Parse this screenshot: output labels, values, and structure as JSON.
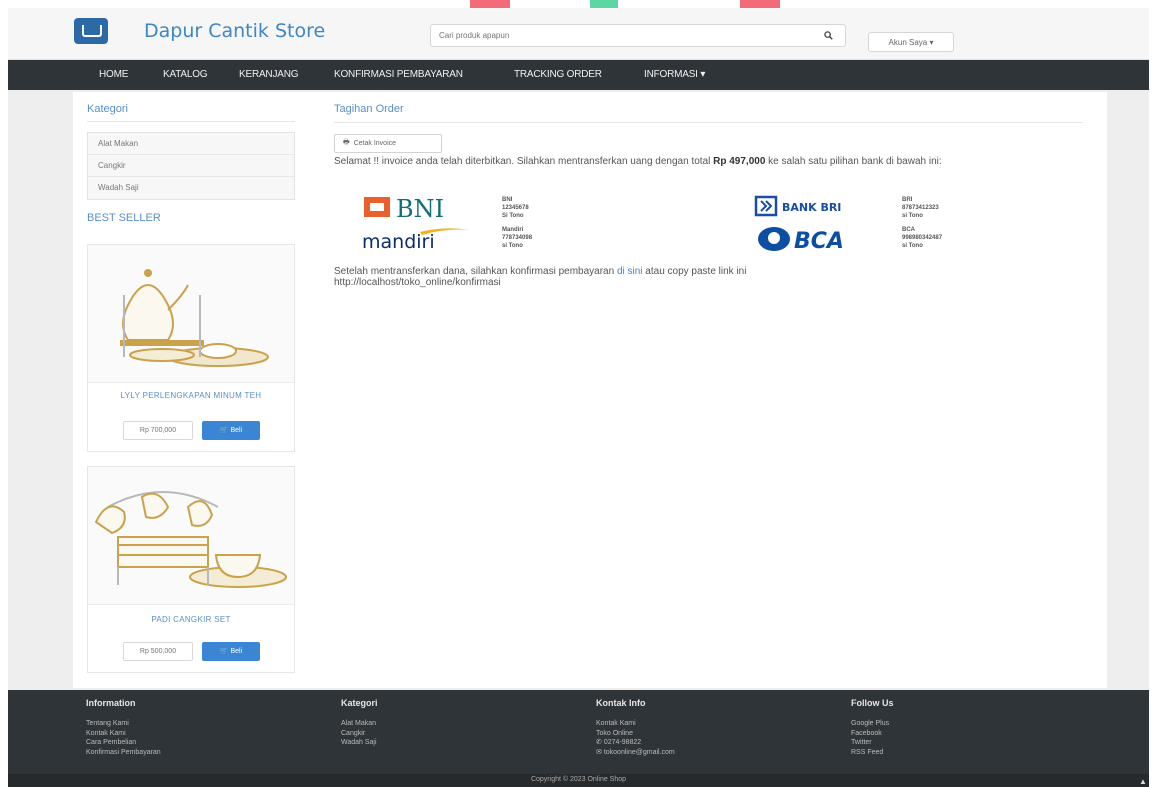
{
  "header": {
    "store_name": "Dapur Cantik Store",
    "search_placeholder": "Cari produk apapun",
    "account_label": "Akun Saya ▾"
  },
  "nav": {
    "items": [
      "HOME",
      "KATALOG",
      "KERANJANG",
      "KONFIRMASI PEMBAYARAN",
      "TRACKING ORDER",
      "INFORMASI ▾"
    ]
  },
  "sidebar": {
    "category_title": "Kategori",
    "categories": [
      "Alat Makan",
      "Cangkir",
      "Wadah Saji"
    ],
    "best_seller_title": "BEST SELLER",
    "products": [
      {
        "name": "LYLY PERLENGKAPAN MINUM TEH",
        "price": "Rp 700,000",
        "buy_label": "Beli"
      },
      {
        "name": "PADI CANGKIR SET",
        "price": "Rp 500,000",
        "buy_label": "Beli"
      }
    ]
  },
  "content": {
    "title": "Tagihan Order",
    "print_label": "Cetak Invoice",
    "message_before": "Selamat !! invoice anda telah diterbitkan. Silahkan mentransferkan uang dengan total ",
    "total": "Rp 497,000",
    "message_after": " ke salah satu pilihan bank di bawah ini:",
    "banks": [
      {
        "logo": "BNI",
        "lines": [
          "BNI",
          "12345678",
          "Si Tono"
        ]
      },
      {
        "logo": "mandiri",
        "lines": [
          "Mandiri",
          "778734098",
          "si Tono"
        ]
      },
      {
        "logo": "BANK BRI",
        "lines": [
          "BRI",
          "87873412323",
          "si Tono"
        ]
      },
      {
        "logo": "BCA",
        "lines": [
          "BCA",
          "998980342487",
          "si Tono"
        ]
      }
    ],
    "confirm_before": "Setelah mentransferkan dana, silahkan konfirmasi pembayaran ",
    "confirm_link": "di sini",
    "confirm_after": " atau copy paste link ini",
    "confirm_url": "http://localhost/toko_online/konfirmasi"
  },
  "footer": {
    "columns": [
      {
        "title": "Information",
        "items": [
          "Tentang Kami",
          "Kontak Kami",
          "Cara Pembelian",
          "Konfirmasi Pembayaran"
        ]
      },
      {
        "title": "Kategori",
        "items": [
          "Alat Makan",
          "Cangkir",
          "Wadah Saji"
        ]
      },
      {
        "title": "Kontak Info",
        "items": [
          "Kontak Kami",
          "Toko Online",
          "0274-98822",
          "tokoonline@gmail.com"
        ]
      },
      {
        "title": "Follow Us",
        "items": [
          "Google Plus",
          "Facebook",
          "Twitter",
          "RSS Feed"
        ]
      }
    ],
    "copyright": "Copyright © 2023 Online Shop"
  },
  "colors": {
    "brand_blue": "#3e86c5",
    "nav_dark": "#2f3438",
    "button_blue": "#3a86d4",
    "bni_orange": "#e8602b",
    "bni_teal": "#116e75",
    "bri_blue": "#1a4ea0",
    "bca_blue": "#0b4ea2",
    "mandiri_navy": "#0a2d6b",
    "mandiri_gold": "#f2b21b"
  }
}
